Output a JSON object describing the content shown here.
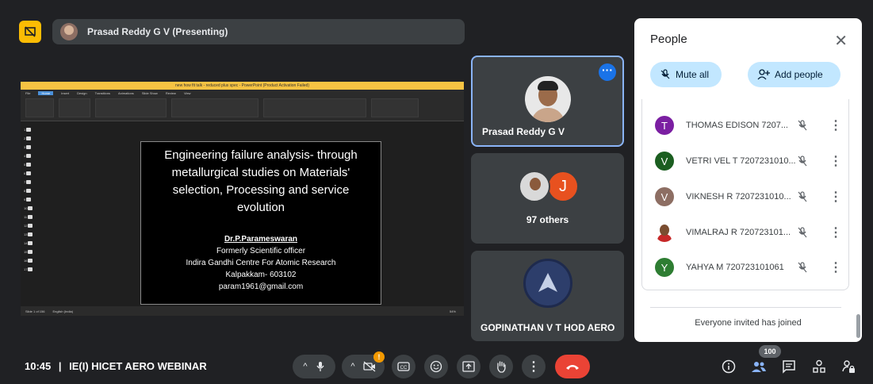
{
  "presenter": {
    "name": "Prasad Reddy G V (Presenting)"
  },
  "ppt": {
    "window_title": "new how fit talk - reduced plus spec - PowerPoint (Product Activation Failed)",
    "tabs": [
      "File",
      "Home",
      "Insert",
      "Design",
      "Transitions",
      "Animations",
      "Slide Show",
      "Review",
      "View"
    ],
    "status_left": "Slide 1 of 156",
    "status_lang": "English (India)",
    "zoom": "54%"
  },
  "slide": {
    "title": "Engineering failure analysis- through metallurgical studies on Materials' selection, Processing and service evolution",
    "author": "Dr.P.Parameswaran",
    "lines": [
      "Formerly Scientific officer",
      "Indira Gandhi Centre For Atomic Research",
      "Kalpakkam- 603102",
      "param1961@gmail.com"
    ]
  },
  "tiles": [
    {
      "name": "Prasad Reddy G V"
    },
    {
      "name": "97 others",
      "avatar_letter": "J"
    },
    {
      "name": "GOPINATHAN V T HOD AERO"
    }
  ],
  "panel": {
    "title": "People",
    "mute_all": "Mute all",
    "add_people": "Add people",
    "participants": [
      {
        "initial": "T",
        "name": "THOMAS EDISON 7207...",
        "color": "#7b1fa2"
      },
      {
        "initial": "V",
        "name": "VETRI VEL T 7207231010...",
        "color": "#1b5e20"
      },
      {
        "initial": "V",
        "name": "VIKNESH R 7207231010...",
        "color": "#8d6e63"
      },
      {
        "initial": "",
        "name": "VIMALRAJ R 720723101...",
        "color": "#ffffff"
      },
      {
        "initial": "Y",
        "name": "YAHYA M 720723101061",
        "color": "#2e7d32"
      }
    ],
    "invited": "Everyone invited has joined"
  },
  "bottom": {
    "time": "10:45",
    "separator": "|",
    "meeting_name": "IE(I) HICET AERO WEBINAR",
    "alert": "!",
    "people_count": "100"
  }
}
